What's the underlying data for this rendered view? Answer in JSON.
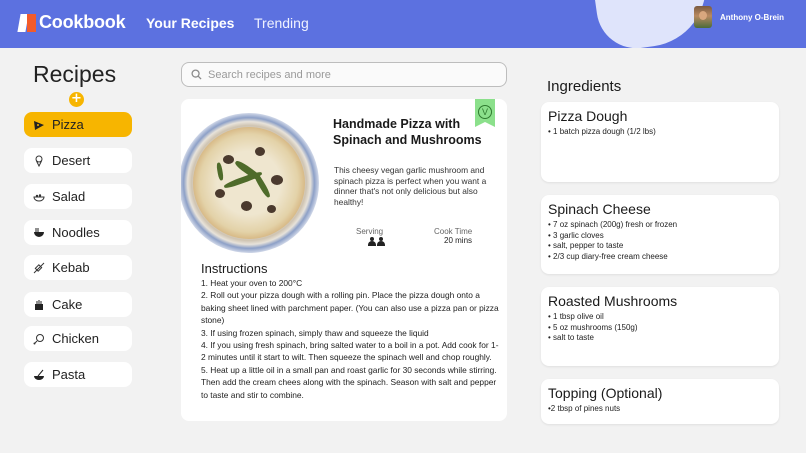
{
  "header": {
    "logo_text": "Cookbook",
    "nav": [
      "Your Recipes",
      "Trending"
    ],
    "user_name": "Anthony O-Brein"
  },
  "sidebar": {
    "title": "Recipes",
    "add_icon": "+",
    "categories": [
      {
        "label": "Pizza",
        "icon": "pizza-icon",
        "active": true
      },
      {
        "label": "Desert",
        "icon": "ice-cream-icon",
        "active": false
      },
      {
        "label": "Salad",
        "icon": "salad-bowl-icon",
        "active": false
      },
      {
        "label": "Noodles",
        "icon": "noodle-bowl-icon",
        "active": false
      },
      {
        "label": "Kebab",
        "icon": "kebab-icon",
        "active": false
      },
      {
        "label": "Cake",
        "icon": "cake-icon",
        "active": false
      },
      {
        "label": "Chicken",
        "icon": "chicken-icon",
        "active": false
      },
      {
        "label": "Pasta",
        "icon": "pasta-icon",
        "active": false
      }
    ]
  },
  "search": {
    "placeholder": "Search recipes and more"
  },
  "recipe": {
    "title": "Handmade Pizza with Spinach and Mushrooms",
    "description": "This cheesy vegan garlic mushroom and spinach pizza is perfect when you want a dinner that's not only delicious but also healthy!",
    "badge": "V",
    "serving_label": "Serving",
    "cook_time_label": "Cook Time",
    "cook_time_value": "20 mins",
    "instructions_title": "Instructions",
    "instructions": [
      "1. Heat your oven to 200°C",
      "2. Roll out your pizza dough with a rolling pin. Place the pizza dough onto a baking sheet lined with parchment paper. (You can also use a pizza pan or pizza stone)",
      "3. If using frozen spinach, simply thaw and squeeze the liquid",
      "4. If you using fresh spinach, bring salted water to a boil in a pot. Add cook for 1-2 minutes until it start to wilt. Then squeeze the spinach well and chop roughly.",
      "5. Heat up a little oil in a small pan and roast garlic for 30 seconds while stirring. Then add the cream chees along with the spinach. Season with salt and pepper to taste and stir to combine."
    ]
  },
  "ingredients": {
    "title": "Ingredients",
    "groups": [
      {
        "title": "Pizza Dough",
        "items": [
          "• 1 batch pizza dough  (1/2 lbs)"
        ]
      },
      {
        "title": "Spinach Cheese",
        "items": [
          "• 7 oz spinach (200g) fresh or frozen",
          "• 3 garlic cloves",
          "• salt, pepper to taste",
          "• 2/3 cup diary-free cream cheese"
        ]
      },
      {
        "title": "Roasted Mushrooms",
        "items": [
          "• 1 tbsp olive oil",
          "• 5 oz mushrooms (150g)",
          "• salt to taste"
        ]
      },
      {
        "title": "Topping (Optional)",
        "items": [
          "•2 tbsp of pines nuts"
        ]
      }
    ]
  },
  "colors": {
    "header": "#5c71e0",
    "accent": "#f7b500",
    "vegan_badge": "#8be08b"
  }
}
